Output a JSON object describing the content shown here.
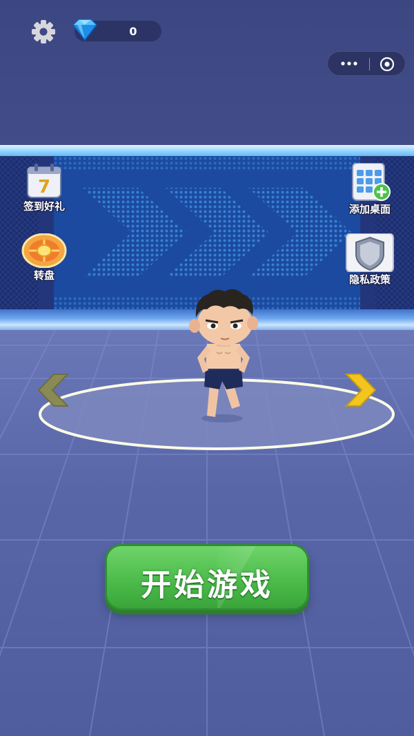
{
  "top_bar": {
    "settings_icon": "gear-icon",
    "currency_icon": "diamond-icon",
    "diamond_count": "0",
    "menu_icon": "more-dots-icon",
    "close_icon": "target-circle-icon"
  },
  "left_buttons": [
    {
      "icon": "calendar-icon",
      "calendar_day": "7",
      "label": "签到好礼"
    },
    {
      "icon": "lucky-wheel-icon",
      "label": "转盘"
    }
  ],
  "right_buttons": [
    {
      "icon": "phone-add-icon",
      "label": "添加桌面"
    },
    {
      "icon": "shield-icon",
      "label": "隐私政策"
    }
  ],
  "carousel": {
    "prev_icon": "chevron-left-icon",
    "next_icon": "chevron-right-icon"
  },
  "start_button": {
    "label": "开始游戏"
  },
  "colors": {
    "header_bg": "#3f4a86",
    "start_green": "#4cbc4b",
    "arrow_yellow": "#f2c51f",
    "arrow_dim": "#8a8a55"
  }
}
